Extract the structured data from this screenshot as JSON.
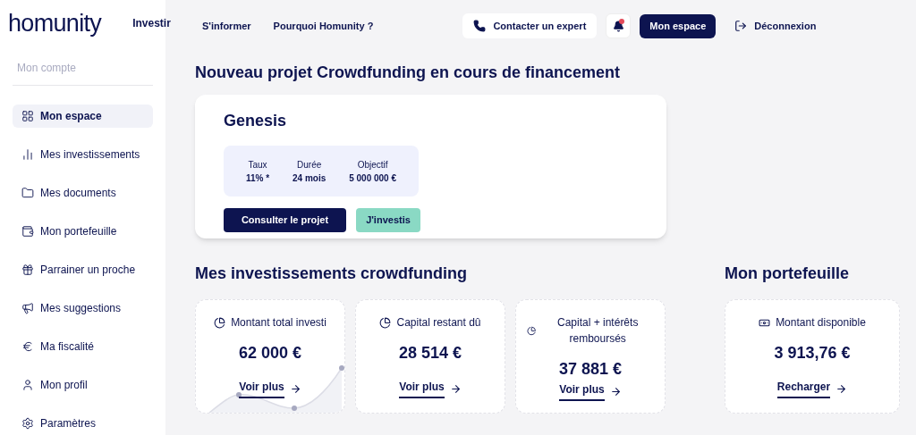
{
  "logo": "homunity",
  "nav": [
    {
      "label": "Investir"
    },
    {
      "label": "S'informer"
    },
    {
      "label": "Pourquoi Homunity ?"
    }
  ],
  "header_actions": {
    "contact": "Contacter un expert",
    "notifications_unread": true,
    "space": "Mon espace",
    "logout": "Déconnexion"
  },
  "sidebar": {
    "title": "Mon compte",
    "items": [
      {
        "label": "Mon espace",
        "selected": true
      },
      {
        "label": "Mes investissements",
        "selected": false
      },
      {
        "label": "Mes documents",
        "selected": false
      },
      {
        "label": "Mon portefeuille",
        "selected": false
      },
      {
        "label": "Parrainer un proche",
        "selected": false
      },
      {
        "label": "Mes suggestions",
        "selected": false
      },
      {
        "label": "Ma fiscalité",
        "selected": false
      },
      {
        "label": "Mon profil",
        "selected": false
      },
      {
        "label": "Paramètres",
        "selected": false
      }
    ]
  },
  "project_section": {
    "title": "Nouveau projet Crowdfunding en cours de financement",
    "project": {
      "name": "Genesis",
      "facts": [
        {
          "label": "Taux",
          "value": "11% *"
        },
        {
          "label": "Durée",
          "value": "24 mois"
        },
        {
          "label": "Objectif",
          "value": "5 000 000 €"
        }
      ],
      "primary_button": "Consulter le projet",
      "secondary_button": "J'investis"
    }
  },
  "investments": {
    "title": "Mes investissements crowdfunding",
    "cards": [
      {
        "label": "Montant total investi",
        "amount": "62 000 €",
        "link": "Voir plus",
        "sparkline": true
      },
      {
        "label": "Capital restant dû",
        "amount": "28 514 €",
        "link": "Voir plus",
        "sparkline": false
      },
      {
        "label": "Capital + intérêts remboursés",
        "amount": "37 881 €",
        "link": "Voir plus",
        "sparkline": false
      }
    ]
  },
  "wallet": {
    "title": "Mon portefeuille",
    "card": {
      "label": "Montant disponible",
      "amount": "3 913,76 €",
      "link": "Recharger"
    }
  }
}
